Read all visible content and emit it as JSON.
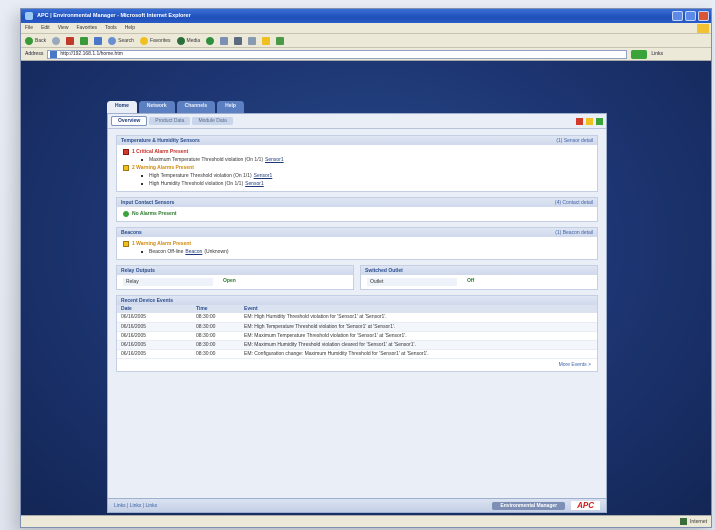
{
  "window": {
    "title": "APC | Environmental Manager - Microsoft Internet Explorer"
  },
  "menubar": {
    "items": [
      "File",
      "Edit",
      "View",
      "Favorites",
      "Tools",
      "Help"
    ]
  },
  "toolbar": {
    "back": "Back",
    "search": "Search",
    "favorites": "Favorites",
    "media": "Media"
  },
  "addressbar": {
    "label": "Address",
    "url": "http://192.168.1.1/home.htm",
    "go": "Go",
    "links": "Links"
  },
  "app": {
    "tabs": [
      "Home",
      "Network",
      "Channels",
      "Help"
    ],
    "subtabs": [
      "Overview",
      "Product Data",
      "Module Data"
    ],
    "sections": {
      "temp_humidity": {
        "title": "Temperature & Humidity Sensors",
        "link": "(1) Sensor detail",
        "critical": "1 Critical Alarm Present",
        "critical_detail": "Maximum Temperature Threshold violation (On 1/1)",
        "critical_detail_link": "Sensor1",
        "warning": "2 Warning Alarms Present",
        "warning_details": [
          {
            "text": "High Temperature Threshold violation (On 1/1)",
            "link": "Sensor1"
          },
          {
            "text": "High Humidity Threshold violation (On 1/1)",
            "link": "Sensor1"
          }
        ]
      },
      "input_contacts": {
        "title": "Input Contact Sensors",
        "link": "(4) Contact detail",
        "ok": "No Alarms Present"
      },
      "beacons": {
        "title": "Beacons",
        "link": "(1) Beacon detail",
        "warning": "1 Warning Alarm Present",
        "detail": "Beacon Off-line",
        "detail_link": "Beacon",
        "detail_suffix": "(Unknown)"
      },
      "relay": {
        "title": "Relay Outputs",
        "key": "Relay",
        "value": "Open"
      },
      "switched": {
        "title": "Switched Outlet",
        "key": "Outlet",
        "value": "Off"
      },
      "events": {
        "title": "Recent Device Events",
        "headers": [
          "Date",
          "Time",
          "Event"
        ],
        "rows": [
          [
            "06/16/2005",
            "08:30:00",
            "EM: High Humidity Threshold violation for 'Sensor1' at 'Sensor1'."
          ],
          [
            "06/16/2005",
            "08:30:00",
            "EM: High Temperature Threshold violation for 'Sensor1' at 'Sensor1'."
          ],
          [
            "06/16/2005",
            "08:30:00",
            "EM: Maximum Temperature Threshold violation for 'Sensor1' at 'Sensor1'."
          ],
          [
            "06/16/2005",
            "08:30:00",
            "EM: Maximum Humidity Threshold violation cleared for 'Sensor1' at 'Sensor1'."
          ],
          [
            "06/16/2005",
            "08:30:00",
            "EM: Configuration change: Maximum Humidity Threshold for 'Sensor1' at 'Sensor1'."
          ]
        ],
        "view_more": "More Events >"
      }
    },
    "footer": {
      "links": "Links | Links | Links",
      "product": "Environmental Manager",
      "logo": "APC"
    }
  },
  "statusbar": {
    "status": "",
    "zone": "Internet"
  }
}
